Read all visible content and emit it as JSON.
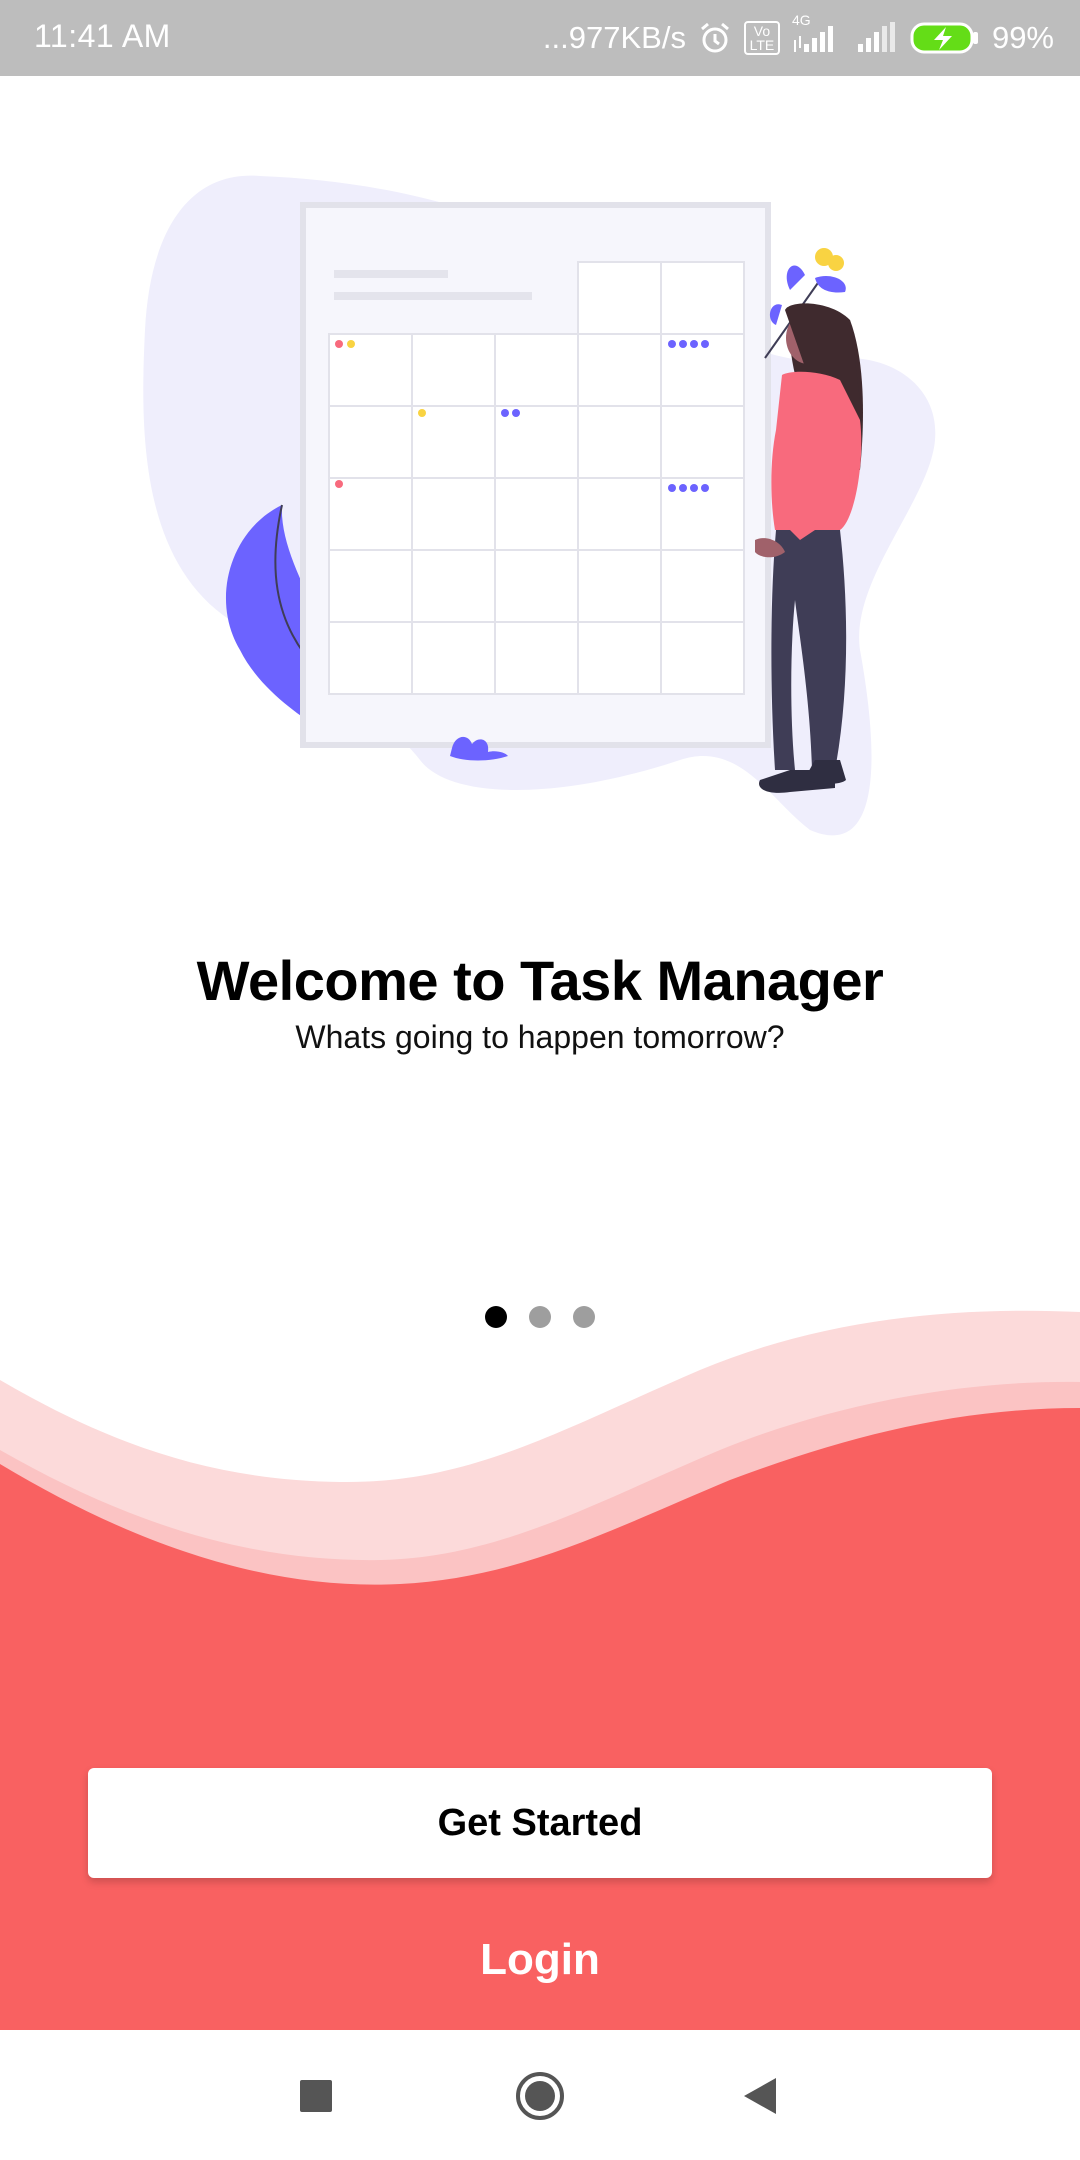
{
  "status_bar": {
    "time": "11:41 AM",
    "net_speed": "...977KB/s",
    "volte": "Vo LTE",
    "network_type": "4G",
    "battery": "99%",
    "icons": [
      "alarm-icon",
      "volte-icon",
      "signal-icon",
      "signal-icon",
      "battery-charging-icon"
    ]
  },
  "welcome": {
    "title": "Welcome to Task Manager",
    "subtitle": "Whats going to happen tomorrow?"
  },
  "pager": {
    "count": 3,
    "active_index": 0
  },
  "actions": {
    "get_started": "Get Started",
    "login": "Login"
  },
  "nav": {
    "icons": [
      "recents-square-icon",
      "home-circle-icon",
      "back-triangle-icon"
    ]
  },
  "colors": {
    "accent": "#f96161",
    "wave_light": "#fcdada",
    "wave_mid": "#fbc3c3",
    "illustration_purple": "#6c63ff",
    "person_shirt": "#f86a7d"
  }
}
